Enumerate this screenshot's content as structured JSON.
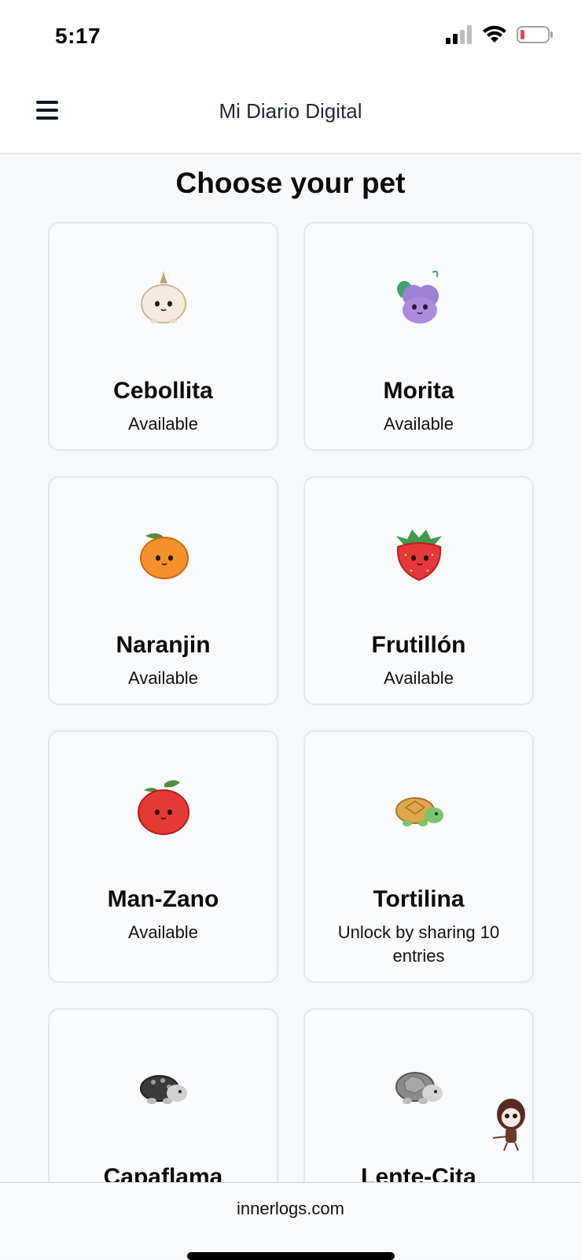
{
  "status_bar": {
    "time": "5:17",
    "icons": [
      "signal-icon",
      "wifi-icon",
      "battery-low-icon"
    ]
  },
  "header": {
    "title": "Mi Diario Digital",
    "menu_icon": "hamburger-menu-icon"
  },
  "page": {
    "title": "Choose your pet"
  },
  "pets": [
    {
      "name": "Cebollita",
      "status": "Available",
      "icon": "onion-pet-icon"
    },
    {
      "name": "Morita",
      "status": "Available",
      "icon": "grape-pet-icon"
    },
    {
      "name": "Naranjin",
      "status": "Available",
      "icon": "orange-pet-icon"
    },
    {
      "name": "Frutillón",
      "status": "Available",
      "icon": "strawberry-pet-icon"
    },
    {
      "name": "Man-Zano",
      "status": "Available",
      "icon": "apple-pet-icon"
    },
    {
      "name": "Tortilina",
      "status": "Unlock by sharing 10 entries",
      "icon": "turtle-pet-icon"
    },
    {
      "name": "Capaflama",
      "status": "",
      "icon": "shell-turtle-locked-icon"
    },
    {
      "name": "Lente-Cita",
      "status": "",
      "icon": "rock-turtle-locked-icon"
    }
  ],
  "footer": {
    "domain": "innerlogs.com"
  },
  "colors": {
    "background": "#f7f8fa",
    "card_border": "#e5e7eb",
    "header_bg": "#ffffff"
  }
}
